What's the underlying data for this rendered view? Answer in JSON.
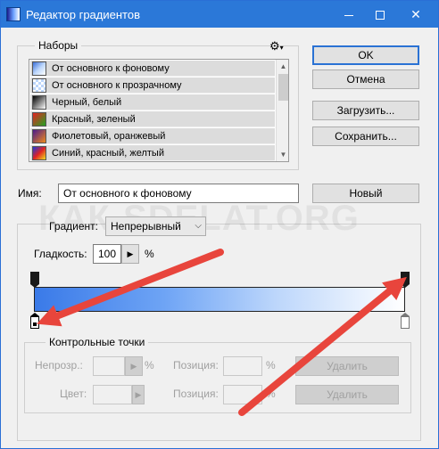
{
  "window": {
    "title": "Редактор градиентов",
    "controls": {
      "minimize": "",
      "maximize": "",
      "close": "✕"
    }
  },
  "presets": {
    "group_label": "Наборы",
    "menu_icon": "gear-icon",
    "items": [
      {
        "label": "От основного к фоновому",
        "swatch": "linear-gradient(135deg,#3a6fd8,#bcd6fb,#ffffff)"
      },
      {
        "label": "От основного к прозрачному",
        "swatch": "repeating-conic-gradient(#bcd6fb 0 25%, #ffffff 0 50%) 0 0/6px 6px"
      },
      {
        "label": "Черный, белый",
        "swatch": "linear-gradient(135deg,#000000,#ffffff)"
      },
      {
        "label": "Красный, зеленый",
        "swatch": "linear-gradient(135deg,#e52222,#22a322)"
      },
      {
        "label": "Фиолетовый, оранжевый",
        "swatch": "linear-gradient(135deg,#4a1a8c,#f08a1a)"
      },
      {
        "label": "Синий, красный, желтый",
        "swatch": "linear-gradient(135deg,#1a3ae0,#e02222,#f0e020)"
      }
    ]
  },
  "buttons": {
    "ok": "OK",
    "cancel": "Отмена",
    "load": "Загрузить...",
    "save": "Сохранить...",
    "new": "Новый"
  },
  "name_field": {
    "label": "Имя:",
    "value": "От основного к фоновому"
  },
  "gradient": {
    "type_label": "Градиент:",
    "type_value": "Непрерывный",
    "smoothness_label": "Гладкость:",
    "smoothness_value": "100",
    "smoothness_unit": "%"
  },
  "stops": {
    "group_label": "Контрольные точки",
    "opacity_label": "Непрозр.:",
    "opacity_value": "",
    "opacity_unit": "%",
    "position1_label": "Позиция:",
    "position1_value": "",
    "position1_unit": "%",
    "delete1_label": "Удалить",
    "color_label": "Цвет:",
    "position2_label": "Позиция:",
    "position2_value": "",
    "position2_unit": "%",
    "delete2_label": "Удалить"
  },
  "watermark": "КАК-SDELAT.ORG",
  "colors": {
    "titlebar": "#2b78d8",
    "arrow": "#e8453c",
    "gradient_start": "#3a7ae8",
    "gradient_end": "#ffffff"
  }
}
